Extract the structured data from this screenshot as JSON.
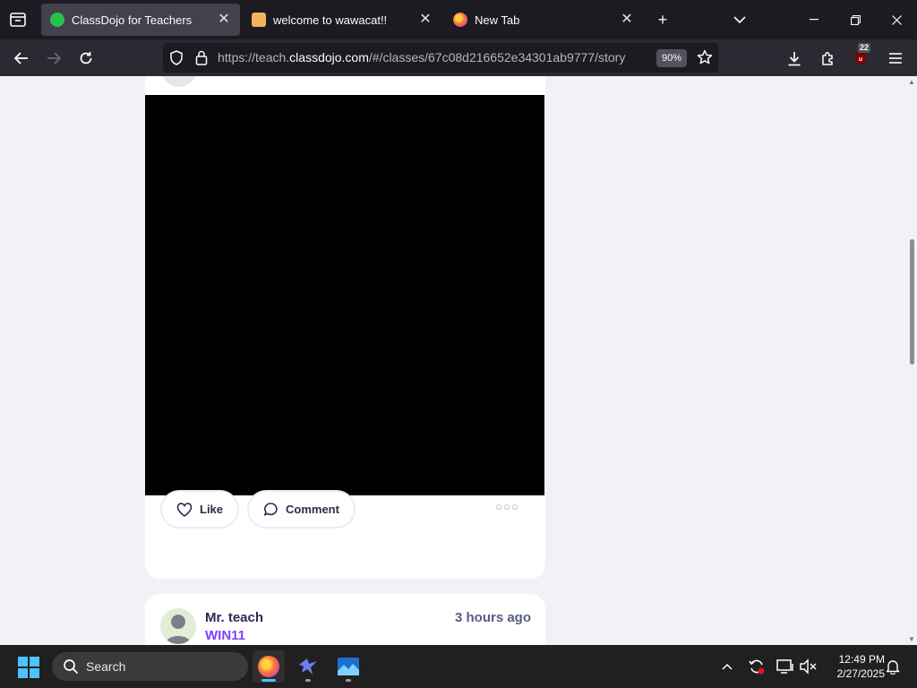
{
  "browser": {
    "tabs": [
      {
        "title": "ClassDojo for Teachers",
        "active": true
      },
      {
        "title": "welcome to wawacat!!",
        "active": false
      },
      {
        "title": "New Tab",
        "active": false
      }
    ],
    "url_prefix": "https://teach.",
    "url_domain": "classdojo.com",
    "url_suffix": "/#/classes/67c08d216652e34301ab9777/story",
    "zoom": "90%",
    "extension_badge": "22"
  },
  "post": {
    "like_label": "Like",
    "comment_label": "Comment"
  },
  "next_post": {
    "author": "Mr. teach",
    "class_name": "WIN11",
    "time_ago": "3 hours ago"
  },
  "taskbar": {
    "search_label": "Search",
    "time": "12:49 PM",
    "date": "2/27/2025"
  }
}
